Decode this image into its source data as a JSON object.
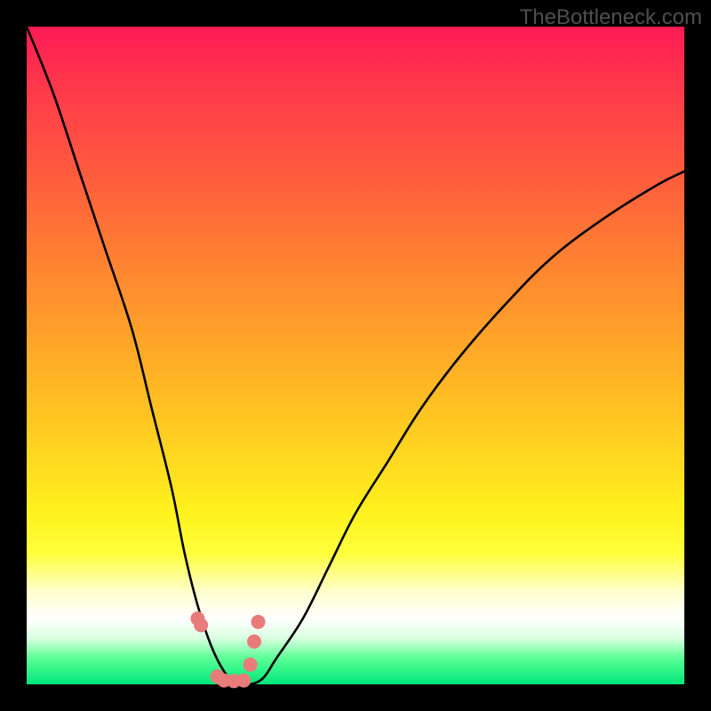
{
  "watermark": "TheBottleneck.com",
  "chart_data": {
    "type": "line",
    "title": "",
    "xlabel": "",
    "ylabel": "",
    "xlim": [
      0,
      100
    ],
    "ylim": [
      0,
      100
    ],
    "series": [
      {
        "name": "bottleneck-curve",
        "x": [
          0,
          4,
          8,
          12,
          16,
          19,
          22,
          24,
          26,
          28,
          30,
          32,
          34,
          36,
          38,
          42,
          46,
          50,
          55,
          60,
          66,
          73,
          80,
          88,
          96,
          100
        ],
        "values": [
          100,
          90,
          78,
          66,
          54,
          42,
          30,
          20,
          12,
          6,
          2,
          0,
          0,
          1,
          4,
          10,
          18,
          26,
          34,
          42,
          50,
          58,
          65,
          71,
          76,
          78
        ]
      }
    ],
    "markers": {
      "x": [
        26.0,
        26.5,
        29.0,
        30.0,
        31.5,
        33.0,
        34.0,
        34.6,
        35.2
      ],
      "values": [
        10.0,
        9.0,
        1.2,
        0.6,
        0.5,
        0.6,
        3.0,
        6.5,
        9.5
      ],
      "color": "#e97b7b",
      "size": 16
    },
    "gradient_stops": [
      {
        "pos": 0.0,
        "color": "#ff1a54"
      },
      {
        "pos": 0.55,
        "color": "#ffb924"
      },
      {
        "pos": 0.8,
        "color": "#ffff3a"
      },
      {
        "pos": 0.9,
        "color": "#ffffff"
      },
      {
        "pos": 1.0,
        "color": "#00e67a"
      }
    ]
  }
}
